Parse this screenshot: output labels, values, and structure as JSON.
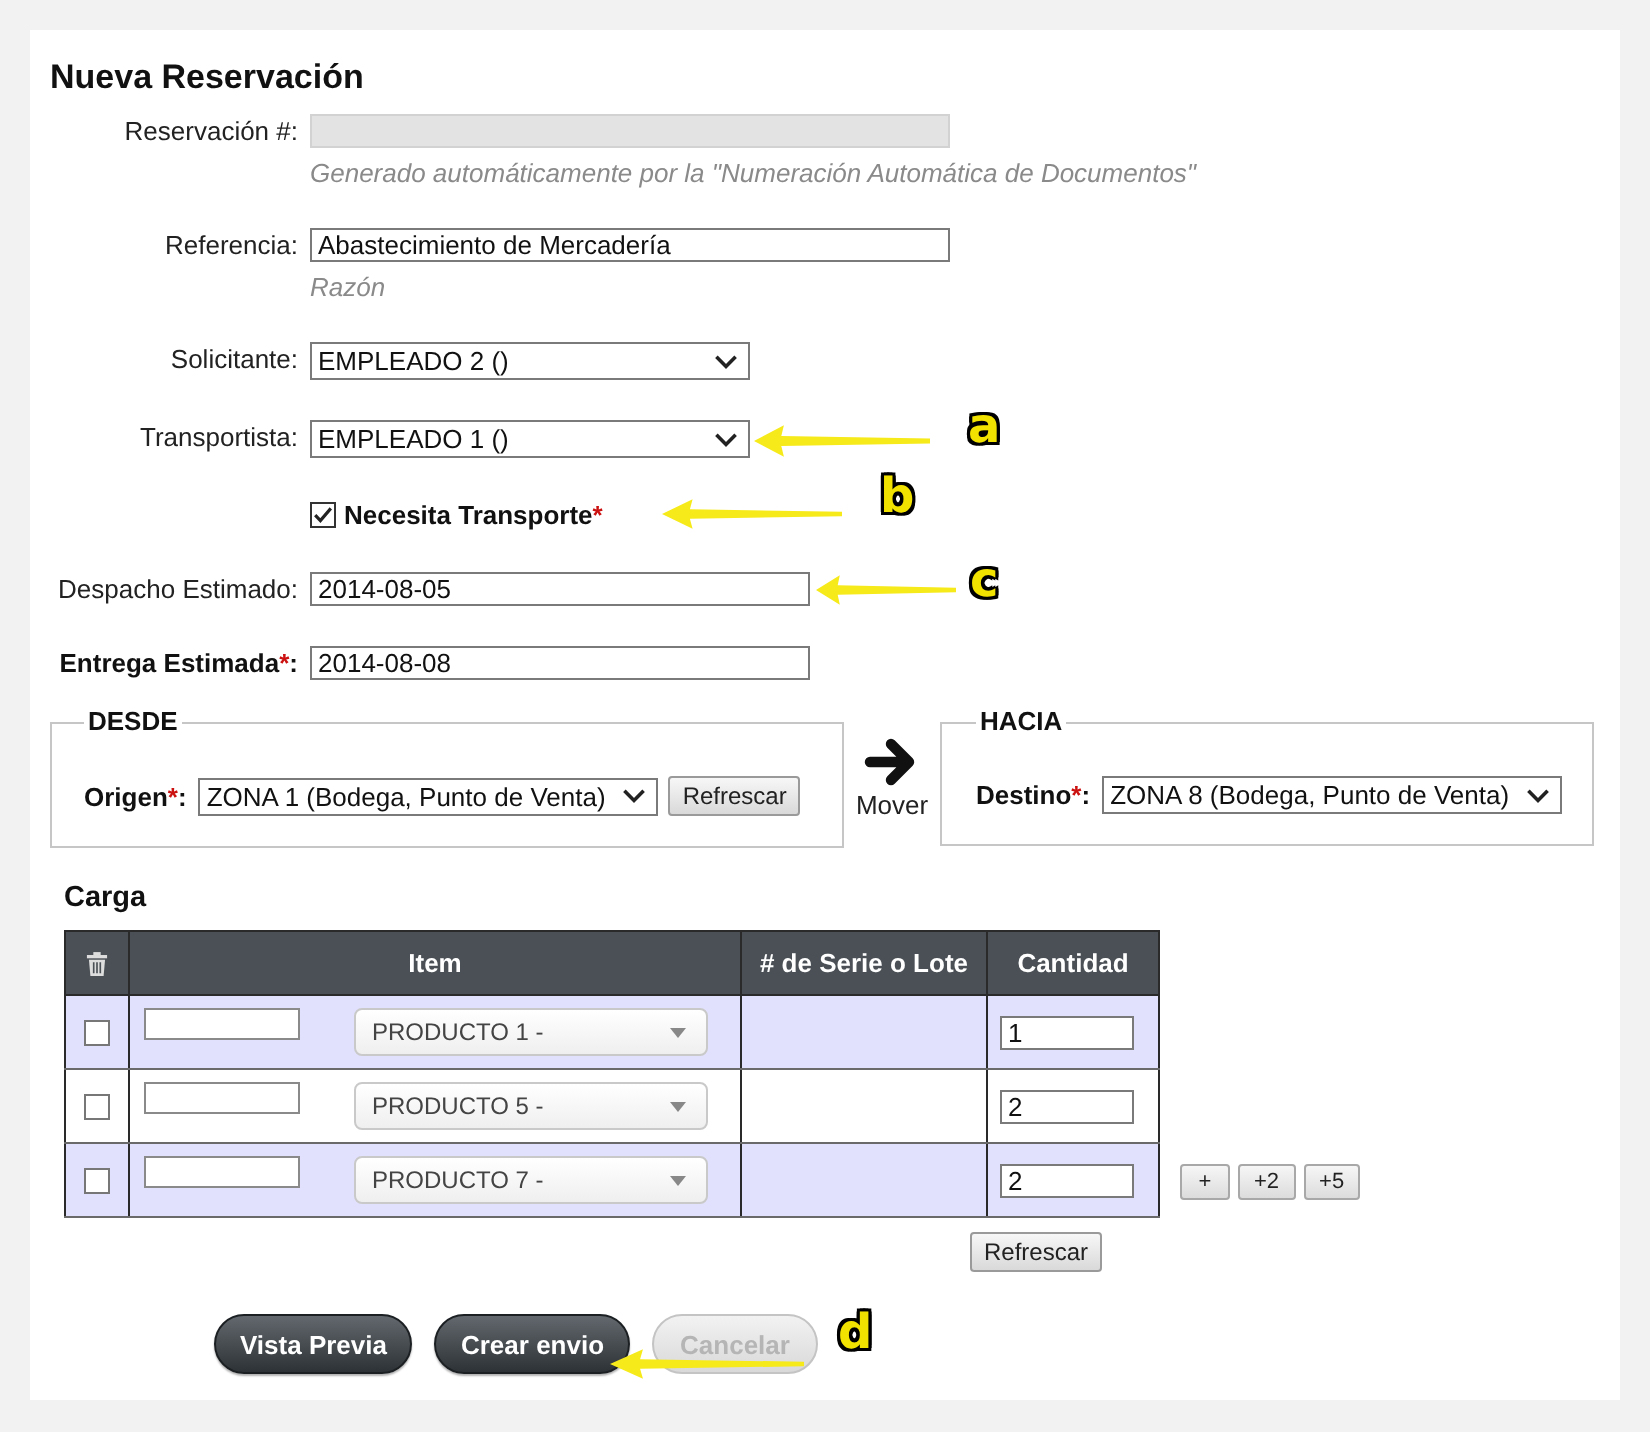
{
  "page": {
    "title": "Nueva Reservación"
  },
  "form_rows": [
    {
      "kind": "text",
      "label": "Reservación #:",
      "disabled": true,
      "hint": "Generado automáticamente por la \"Numeración Automática de Documentos\""
    },
    {
      "kind": "text",
      "label": "Referencia:",
      "disabled": false,
      "value": "Abastecimiento de Mercadería",
      "hint": "Razón"
    },
    {
      "kind": "select",
      "label": "Solicitante:",
      "value": "EMPLEADO 2 ()"
    },
    {
      "kind": "select",
      "label": "Transportista:",
      "value": "EMPLEADO 1 ()"
    },
    {
      "kind": "checkbox",
      "label": "Necesita Transporte",
      "required_mark": "*",
      "checked": true
    },
    {
      "kind": "date",
      "label": "Despacho Estimado:",
      "value": "2014-08-05"
    },
    {
      "kind": "date",
      "label": "Entrega Estimada",
      "required_mark": "*",
      "suffix": ":",
      "value": "2014-08-08"
    }
  ],
  "transfer": {
    "from": {
      "legend": "DESDE",
      "label": "Origen",
      "required_mark": "*",
      "suffix": ":",
      "value": "ZONA 1 (Bodega, Punto de Venta)",
      "button": "Refrescar"
    },
    "move": {
      "label": "Mover"
    },
    "to": {
      "legend": "HACIA",
      "label": "Destino",
      "required_mark": "*",
      "suffix": ":",
      "value": "ZONA 8 (Bodega, Punto de Venta)"
    }
  },
  "cargo": {
    "title": "Carga",
    "columns": [
      "Item",
      "# de Serie o Lote",
      "Cantidad"
    ],
    "rows": [
      {
        "checked": false,
        "product": "PRODUCTO 1 -",
        "quantity": "1"
      },
      {
        "checked": false,
        "product": "PRODUCTO 5 -",
        "quantity": "2"
      },
      {
        "checked": false,
        "product": "PRODUCTO 7 -",
        "quantity": "2"
      }
    ],
    "add_buttons": [
      "+",
      "+2",
      "+5"
    ],
    "refresh_button": "Refrescar"
  },
  "actions": [
    {
      "label": "Vista Previa",
      "disabled": false
    },
    {
      "label": "Crear envio",
      "disabled": false
    },
    {
      "label": "Cancelar",
      "disabled": true
    }
  ],
  "annotations": [
    {
      "letter": "a"
    },
    {
      "letter": "b"
    },
    {
      "letter": "c"
    },
    {
      "letter": "d"
    }
  ]
}
